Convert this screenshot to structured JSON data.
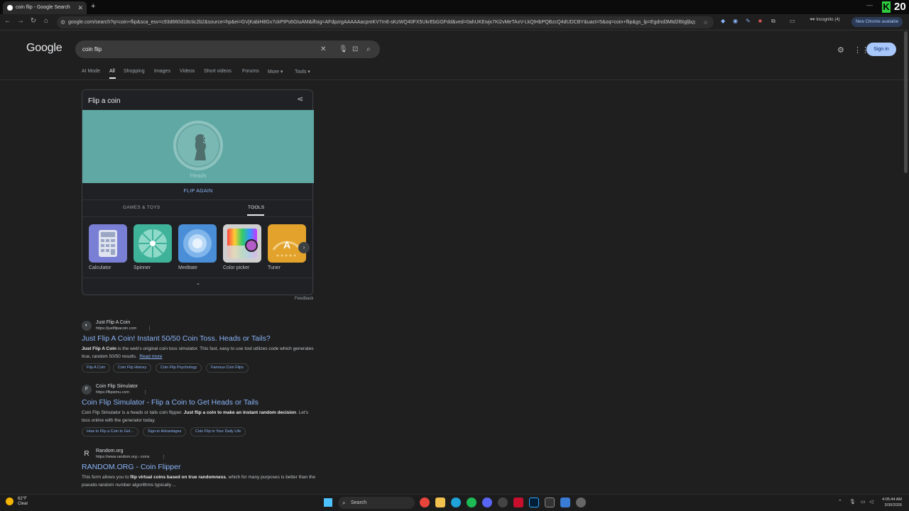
{
  "browser": {
    "tab_title": "coin flip - Google Search",
    "address": "google.com/search?q=coin+flip&sca_esv=c93d660d18ctic2b2&source=hp&ei=GVjKabiH8Gv7ckPIPs6GtuAM&iflsig=AFdpzrgAAAAAacpmKV7rn6-sKzWQ40FX5UkrEbGGFdd&ved=0ahUKEwjx7Ki2vMeTAxV-LkQIHbPQBzcQ4dUDCBY&uact=5&oq=coin+flip&gs_lp=Egdnd3Mtd2l6Igljb",
    "incognito_label": "Incognito (4)",
    "new_chrome_label": "New Chrome available",
    "corner_number": "20"
  },
  "google": {
    "logo": "Google",
    "query": "coin flip",
    "sign_in": "Sign in",
    "nav_tabs": [
      "AI Mode",
      "All",
      "Shopping",
      "Images",
      "Videos",
      "Short videos",
      "Forums",
      "More ▾",
      "Tools ▾"
    ]
  },
  "flip_card": {
    "title": "Flip a coin",
    "result": "Heads",
    "flip_again": "FLIP AGAIN",
    "tabs": [
      "GAMES & TOYS",
      "TOOLS"
    ],
    "tools": [
      "Calculator",
      "Spinner",
      "Meditate",
      "Color picker",
      "Tuner"
    ],
    "feedback": "Feedback"
  },
  "results": [
    {
      "site": "Just Flip A Coin",
      "url": "https://justflipacoin.com",
      "title": "Just Flip A Coin! Instant 50/50 Coin Toss. Heads or Tails?",
      "snippet_bold1": "Just Flip A Coin",
      "snippet_1": " is the web's original coin toss simulator. This fast, easy to use tool utilizes code which generates true, random 50/50 results.",
      "read_more": "Read more",
      "chips": [
        "Flip A Coin",
        "Coin Flip History",
        "Coin Flip Psychology",
        "Famous Coin Flips"
      ]
    },
    {
      "site": "Coin Flip Simulator",
      "url": "https://flipsimu.com",
      "title": "Coin Flip Simulator - Flip a Coin to Get Heads or Tails",
      "snippet_1": "Coin Flip Simulator is a heads or tails coin flipper. ",
      "snippet_bold1": "Just flip a coin to make an instant random decision",
      "snippet_2": ". Let's toss online with the generator today.",
      "chips": [
        "How to Flip a Coin to Get...",
        "Sign-in Advantages",
        "Coin Flip in Your Daily Life"
      ]
    },
    {
      "site": "Random.org",
      "url": "https://www.random.org › coins",
      "title": "RANDOM.ORG - Coin Flipper",
      "snippet_1": "This form allows you to ",
      "snippet_bold1": "flip virtual coins based on true randomness",
      "snippet_2": ", which for many purposes is better than the pseudo-random number algorithms typically ..."
    }
  ],
  "taskbar": {
    "temp": "62°F",
    "weather": "Clear",
    "search": "Search",
    "time": "4:05:44 AM",
    "date": "3/30/2026"
  }
}
